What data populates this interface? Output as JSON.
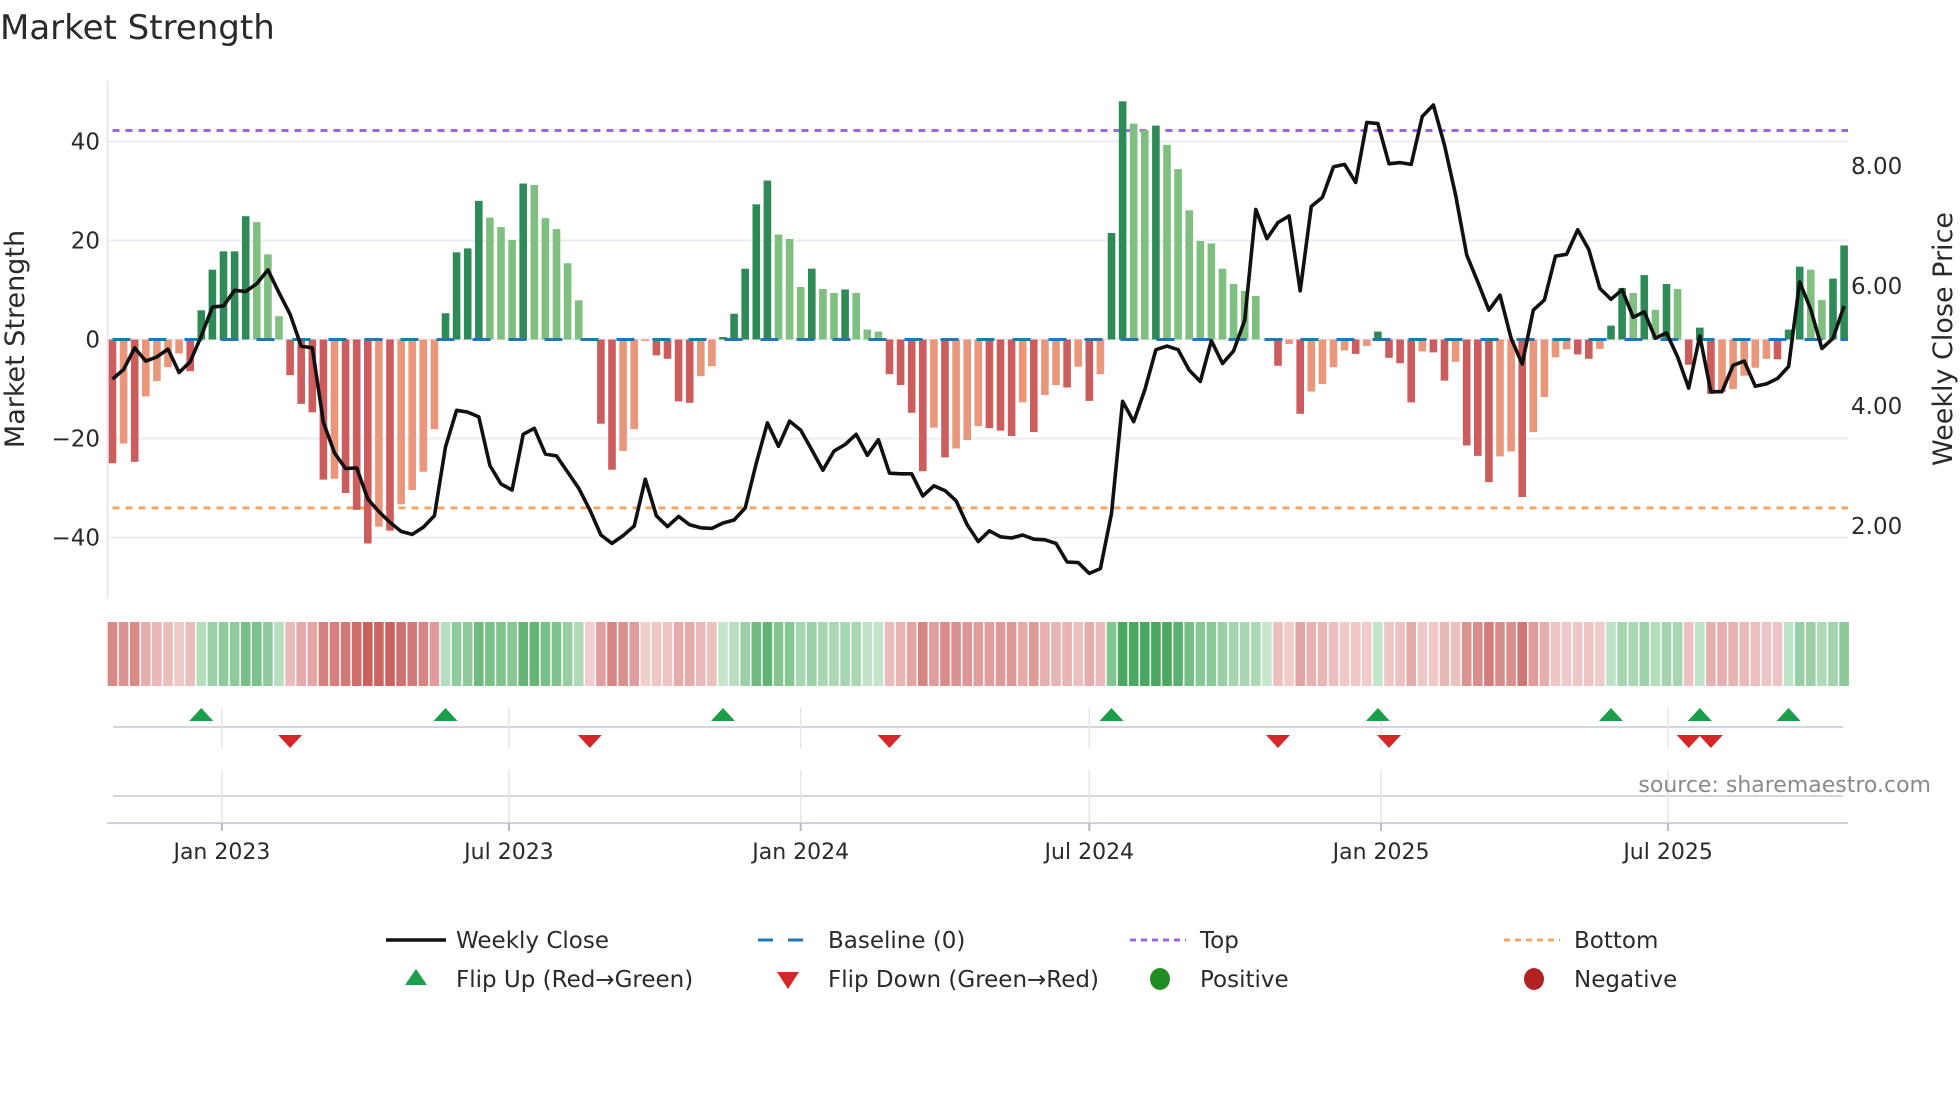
{
  "chart_data": {
    "type": "bar+line",
    "title": "Market Strength",
    "ylabel": "Market Strength",
    "y2label": "Weekly Close Price",
    "ylim": [
      -52.2,
      52.2
    ],
    "y2lim": [
      0.8,
      9.42
    ],
    "yticks": [
      {
        "v": 40,
        "label": "40"
      },
      {
        "v": 20,
        "label": "20"
      },
      {
        "v": 0,
        "label": "0"
      },
      {
        "v": -20,
        "label": "−20"
      },
      {
        "v": -40,
        "label": "−40"
      }
    ],
    "y2ticks": [
      {
        "v": 8,
        "label": "8.00"
      },
      {
        "v": 6,
        "label": "6.00"
      },
      {
        "v": 4,
        "label": "4.00"
      },
      {
        "v": 2,
        "label": "2.00"
      }
    ],
    "start_week": "2022-10-24",
    "xticks": [
      {
        "date": "2023-01-01",
        "label": "Jan 2023"
      },
      {
        "date": "2023-07-01",
        "label": "Jul 2023"
      },
      {
        "date": "2024-01-01",
        "label": "Jan 2024"
      },
      {
        "date": "2024-07-01",
        "label": "Jul 2024"
      },
      {
        "date": "2025-01-01",
        "label": "Jan 2025"
      },
      {
        "date": "2025-07-01",
        "label": "Jul 2025"
      }
    ],
    "top": 42.2,
    "bottom": -34.0,
    "baseline": 0,
    "strength": [
      -25,
      -21,
      -24.7,
      -11.5,
      -8.4,
      -5.6,
      -2.8,
      -6.4,
      5.9,
      14.1,
      17.8,
      17.8,
      24.9,
      23.7,
      17.2,
      4.7,
      -7.2,
      -13,
      -14.7,
      -28.3,
      -28.1,
      -31,
      -34.4,
      -41.2,
      -37.8,
      -38.6,
      -33.3,
      -30.4,
      -26.7,
      -18.1,
      5.3,
      17.6,
      18.4,
      28,
      24.6,
      22.7,
      20.1,
      31.5,
      31.2,
      24.5,
      22.3,
      15.4,
      7.9,
      -0.2,
      -17,
      -26.3,
      -22.5,
      -18.1,
      -0.3,
      -3.2,
      -3.9,
      -12.5,
      -12.8,
      -7.4,
      -5.4,
      0.5,
      5.2,
      14.3,
      27.3,
      32.1,
      21.2,
      20.3,
      10.6,
      14.3,
      10.2,
      9.4,
      10.1,
      9.4,
      2.0,
      1.6,
      -7.0,
      -9.2,
      -14.8,
      -26.6,
      -17.8,
      -23.8,
      -22.0,
      -20.3,
      -17.5,
      -17.9,
      -18.4,
      -19.5,
      -12.7,
      -18.7,
      -11.2,
      -9.2,
      -9.7,
      -5.5,
      -12.4,
      -7.0,
      21.5,
      48.1,
      43.6,
      42.3,
      43.2,
      39.3,
      34.4,
      26.1,
      19.9,
      19.4,
      14.3,
      11.2,
      9.8,
      8.8,
      0,
      -5.3,
      -0.9,
      -15,
      -10.5,
      -9.0,
      -5.6,
      -2.2,
      -2.9,
      -1.3,
      1.6,
      -3.7,
      -4.8,
      -12.7,
      -2.4,
      -2.6,
      -8.3,
      -4.5,
      -21.4,
      -23.5,
      -28.8,
      -23.6,
      -22.6,
      -31.8,
      -18.7,
      -11.6,
      -3.6,
      -2.0,
      -3.0,
      -3.9,
      -1.9,
      2.8,
      10.4,
      9.4,
      13.0,
      6.0,
      11.2,
      10.2,
      -5.1,
      2.4,
      -11.0,
      -10.6,
      -10.0,
      -7.3,
      -5.7,
      -3.9,
      -4.0,
      2.0,
      14.7,
      14.1,
      8.0,
      12.3,
      19.0
    ],
    "weekly_close": [
      4.45,
      4.61,
      4.97,
      4.75,
      4.82,
      4.95,
      4.56,
      4.74,
      5.17,
      5.65,
      5.67,
      5.93,
      5.91,
      6.04,
      6.27,
      5.89,
      5.53,
      5.0,
      4.97,
      3.73,
      3.22,
      2.96,
      2.97,
      2.45,
      2.24,
      2.06,
      1.91,
      1.86,
      1.98,
      2.17,
      3.32,
      3.93,
      3.9,
      3.82,
      3.01,
      2.7,
      2.6,
      3.53,
      3.63,
      3.2,
      3.17,
      2.9,
      2.63,
      2.27,
      1.85,
      1.71,
      1.84,
      2.0,
      2.78,
      2.17,
      1.99,
      2.16,
      2.02,
      1.97,
      1.96,
      2.05,
      2.1,
      2.3,
      3.05,
      3.72,
      3.33,
      3.75,
      3.6,
      3.27,
      2.93,
      3.25,
      3.36,
      3.53,
      3.18,
      3.44,
      2.88,
      2.87,
      2.87,
      2.5,
      2.67,
      2.59,
      2.42,
      2.02,
      1.74,
      1.92,
      1.82,
      1.8,
      1.85,
      1.78,
      1.77,
      1.71,
      1.4,
      1.39,
      1.21,
      1.29,
      2.21,
      4.08,
      3.74,
      4.27,
      4.94,
      5.0,
      4.94,
      4.6,
      4.41,
      5.09,
      4.71,
      4.92,
      5.43,
      7.28,
      6.79,
      7.06,
      7.17,
      5.92,
      7.33,
      7.48,
      7.99,
      8.03,
      7.73,
      8.73,
      8.71,
      8.04,
      8.06,
      8.03,
      8.83,
      9.02,
      8.35,
      7.52,
      6.52,
      6.07,
      5.6,
      5.85,
      5.13,
      4.7,
      5.6,
      5.77,
      6.5,
      6.53,
      6.94,
      6.61,
      5.96,
      5.78,
      5.94,
      5.48,
      5.57,
      5.13,
      5.22,
      4.82,
      4.3,
      5.17,
      4.24,
      4.24,
      4.68,
      4.75,
      4.33,
      4.37,
      4.46,
      4.66,
      6.07,
      5.61,
      4.96,
      5.13,
      5.67
    ],
    "flip_up_weeks": [
      8,
      30,
      55,
      90,
      114,
      135,
      143,
      151
    ],
    "flip_down_weeks": [
      16,
      43,
      70,
      105,
      115,
      142,
      144
    ],
    "legend": [
      {
        "label": "Weekly Close",
        "kind": "line"
      },
      {
        "label": "Baseline (0)",
        "kind": "dash"
      },
      {
        "label": "Top",
        "kind": "dot-purple"
      },
      {
        "label": "Bottom",
        "kind": "dot-orange"
      },
      {
        "label": "Flip Up (Red→Green)",
        "kind": "tri-up"
      },
      {
        "label": "Flip Down (Green→Red)",
        "kind": "tri-down"
      },
      {
        "label": "Positive",
        "kind": "circle-green"
      },
      {
        "label": "Negative",
        "kind": "circle-red"
      }
    ],
    "legend_placement": "bottom"
  },
  "colors": {
    "pos_strong": "#2e8b57",
    "pos_weak": "#7fbf7f",
    "neg_strong": "#cd5c5c",
    "neg_weak": "#e9967a",
    "price": "#111111",
    "top": "#a066e0",
    "bottom": "#f0a868",
    "baseline": "#1f77b4",
    "flip_up": "#1a9e4a",
    "flip_down": "#d62728",
    "positive": "#228b22",
    "negative": "#b22222"
  },
  "source": "source: sharemaestro.com"
}
